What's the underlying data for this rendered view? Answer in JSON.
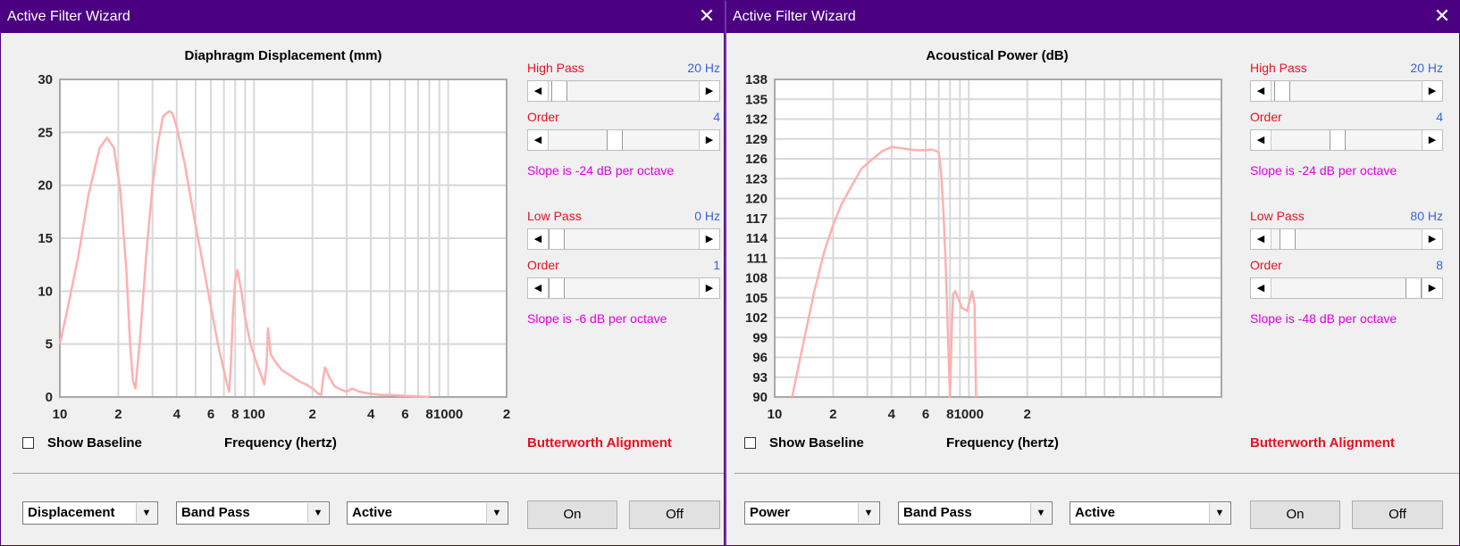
{
  "windows": [
    {
      "title": "Active Filter Wizard",
      "close_glyph": "✕",
      "chart_data": {
        "type": "line",
        "title": "Diaphragm Displacement (mm)",
        "xlabel": "Frequency (hertz)",
        "ylabel": "",
        "x_scale": "log",
        "xlim": [
          10,
          2000
        ],
        "ylim": [
          0,
          30
        ],
        "y_ticks": [
          "0",
          "5",
          "10",
          "15",
          "20",
          "25",
          "30"
        ],
        "x_ticks": [
          {
            "v": 10,
            "label": "10"
          },
          {
            "v": 20,
            "label": "2"
          },
          {
            "v": 40,
            "label": "4"
          },
          {
            "v": 60,
            "label": "6"
          },
          {
            "v": 80,
            "label": "8"
          },
          {
            "v": 100,
            "label": "100"
          },
          {
            "v": 200,
            "label": "2"
          },
          {
            "v": 400,
            "label": "4"
          },
          {
            "v": 600,
            "label": "6"
          },
          {
            "v": 800,
            "label": "8"
          },
          {
            "v": 1000,
            "label": "1000"
          },
          {
            "v": 2000,
            "label": "2"
          }
        ],
        "grid": true,
        "line_color": "#ffb0b0",
        "series": [
          {
            "x": [
              10,
              11,
              12.5,
              14,
              16,
              17.5,
              19,
              20.5,
              22,
              23,
              23.8,
              24.5,
              26,
              28,
              30,
              32,
              34,
              36.5,
              38,
              40,
              44,
              48,
              54,
              60,
              66,
              72,
              74.5,
              76,
              78,
              80,
              82,
              86,
              90,
              96,
              104,
              110,
              113,
              116,
              118,
              122,
              130,
              140,
              155,
              170,
              185,
              200,
              215,
              222,
              226,
              232,
              245,
              260,
              280,
              300,
              320,
              350,
              400,
              450,
              500,
              600,
              700,
              800
            ],
            "y": [
              5,
              8.5,
              13.5,
              19,
              23.5,
              24.5,
              23.5,
              19.5,
              12,
              5,
              1.5,
              0.8,
              6,
              14,
              20,
              24,
              26.5,
              27,
              26.8,
              25.5,
              22,
              18,
              13,
              8.5,
              4.5,
              1.5,
              0.5,
              3,
              8,
              11,
              12,
              10,
              7.5,
              5,
              3,
              1.8,
              1.2,
              3,
              6.5,
              4,
              3.2,
              2.5,
              2,
              1.5,
              1.2,
              0.8,
              0.3,
              0.2,
              1.5,
              2.8,
              1.8,
              1,
              0.7,
              0.5,
              0.8,
              0.5,
              0.3,
              0.2,
              0.2,
              0.1,
              0.05,
              0
            ]
          }
        ]
      },
      "show_baseline": {
        "label": "Show Baseline",
        "checked": false
      },
      "alignment": "Butterworth Alignment",
      "controls": {
        "high_pass": {
          "label": "High Pass",
          "value": "20 Hz",
          "level": 0.02
        },
        "hp_order": {
          "label": "Order",
          "value": "4",
          "level": 0.43
        },
        "hp_slope": "Slope is -24 dB per octave",
        "low_pass": {
          "label": "Low Pass",
          "value": "0 Hz",
          "level": 0.0
        },
        "lp_order": {
          "label": "Order",
          "value": "1",
          "level": 0.0
        },
        "lp_slope": "Slope is -6 dB per octave"
      },
      "selects": [
        "Displacement",
        "Band Pass",
        "Active"
      ],
      "buttons": {
        "on": "On",
        "off": "Off"
      }
    },
    {
      "title": "Active Filter Wizard",
      "close_glyph": "✕",
      "chart_data": {
        "type": "line",
        "title": "Acoustical Power (dB)",
        "xlabel": "Frequency (hertz)",
        "ylabel": "",
        "x_scale": "log",
        "xlim": [
          10,
          2000
        ],
        "ylim": [
          90,
          138
        ],
        "y_ticks": [
          "90",
          "93",
          "96",
          "99",
          "102",
          "105",
          "108",
          "111",
          "114",
          "117",
          "120",
          "123",
          "126",
          "129",
          "132",
          "135",
          "138"
        ],
        "x_ticks": [
          {
            "v": 10,
            "label": "10"
          },
          {
            "v": 20,
            "label": "2"
          },
          {
            "v": 40,
            "label": "4"
          },
          {
            "v": 60,
            "label": "6"
          },
          {
            "v": 80,
            "label": "8"
          },
          {
            "v": 100,
            "label": "1000"
          },
          {
            "v": 200,
            "label": "2"
          }
        ],
        "x_tick_values": [
          10,
          20,
          40,
          60,
          80,
          100,
          200
        ],
        "grid": true,
        "line_color": "#ffb0b0",
        "series": [
          {
            "x": [
              12.3,
              14,
              16,
              18,
              20,
              22,
              25,
              28,
              32,
              36,
              40,
              45,
              50,
              55,
              60,
              65,
              70,
              72,
              74,
              76,
              78,
              79,
              80,
              81,
              82,
              83,
              85,
              88,
              92,
              98,
              104,
              107,
              109
            ],
            "y": [
              90,
              98,
              106,
              112,
              116,
              119,
              122,
              124.5,
              126,
              127.2,
              127.8,
              127.6,
              127.4,
              127.3,
              127.3,
              127.4,
              127,
              124,
              118,
              110,
              100,
              95,
              90,
              96,
              102,
              105.5,
              106,
              105,
              103.5,
              103,
              106,
              104,
              90
            ]
          }
        ]
      },
      "show_baseline": {
        "label": "Show Baseline",
        "checked": false
      },
      "alignment": "Butterworth Alignment",
      "controls": {
        "high_pass": {
          "label": "High Pass",
          "value": "20 Hz",
          "level": 0.02
        },
        "hp_order": {
          "label": "Order",
          "value": "4",
          "level": 0.43
        },
        "hp_slope": "Slope is -24 dB per octave",
        "low_pass": {
          "label": "Low Pass",
          "value": "80 Hz",
          "level": 0.06
        },
        "lp_order": {
          "label": "Order",
          "value": "8",
          "level": 1.0
        },
        "lp_slope": "Slope is -48 dB per octave"
      },
      "selects": [
        "Power",
        "Band Pass",
        "Active"
      ],
      "buttons": {
        "on": "On",
        "off": "Off"
      }
    }
  ]
}
